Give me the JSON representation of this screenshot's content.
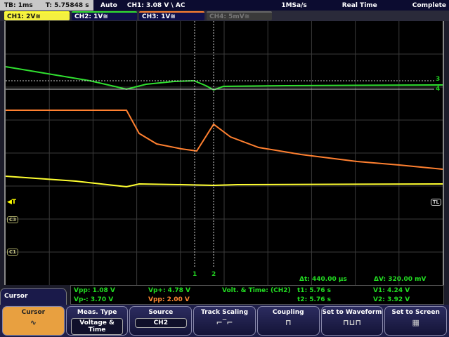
{
  "status": {
    "timebase": "TB: 1ms",
    "trigger_time": "T: 5.75848 s",
    "mode": "Auto",
    "trigger": "CH1: 3.08 V \\ AC",
    "sample_rate": "1MSa/s",
    "acq": "Real Time",
    "state": "Complete"
  },
  "channels": [
    {
      "label": "CH1: 2V≅",
      "color": "#ffff30",
      "bg": "#f4f040",
      "fg": "#111"
    },
    {
      "label": "CH2: 1V≅",
      "color": "#30e030",
      "bg": "#10104a",
      "fg": "#fff"
    },
    {
      "label": "CH3: 1V≅",
      "color": "#ff8030",
      "bg": "#10104a",
      "fg": "#fff"
    },
    {
      "label": "CH4: 5mV≅",
      "color": "#666",
      "bg": "#3a3a3a",
      "fg": "#777"
    }
  ],
  "markers": {
    "trigger": "◀T",
    "trigger_level": "TL",
    "ch3": "C3",
    "ch1": "C1",
    "cursor1": "1",
    "cursor2": "2",
    "cursor3": "3",
    "cursor4": "4"
  },
  "readout": {
    "dt": "Δt: 440.00 µs",
    "dv": "ΔV: 320.00 mV"
  },
  "measurements": {
    "vpp1": "Vpp: 1.08 V",
    "vpm": "Vp-: 3.70 V",
    "vpp_plus": "Vp+: 4.78 V",
    "vpp2": "Vpp: 2.00 V",
    "mode": "Volt. & Time:  (CH2)",
    "t1": "t1: 5.76 s",
    "t2": "t2: 5.76 s",
    "v1": "V1: 4.24 V",
    "v2": "V2: 3.92 V"
  },
  "menu": {
    "title": "Cursor",
    "buttons": [
      {
        "label": "Cursor",
        "icon": "cursor-waveform-icon"
      },
      {
        "label": "Meas. Type",
        "value": "Voltage & Time"
      },
      {
        "label": "Source",
        "value": "CH2"
      },
      {
        "label": "Track Scaling",
        "icon": "track-scaling-icon"
      },
      {
        "label": "Coupling",
        "icon": "coupling-icon"
      },
      {
        "label": "Set to Waveform",
        "icon": "set-to-waveform-icon"
      },
      {
        "label": "Set to Screen",
        "icon": "set-to-screen-icon"
      }
    ]
  }
}
